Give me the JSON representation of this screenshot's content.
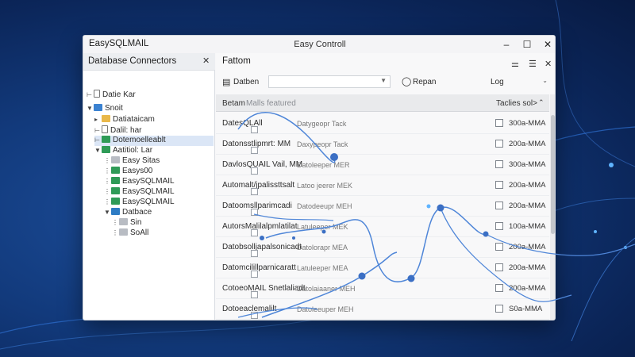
{
  "window": {
    "app_title": "EasySQLMAIL",
    "title": "Easy Controll"
  },
  "left_pane": {
    "title": "Database Connectors",
    "items": [
      {
        "label": "Datie Kar"
      },
      {
        "label": "Snoit"
      },
      {
        "label": "Datiataicam"
      },
      {
        "label": "Dalil: har"
      },
      {
        "label": "Dotemoelleablt"
      },
      {
        "label": "Aatitiol: Lar"
      },
      {
        "label": "Easy Sitas"
      },
      {
        "label": "Easys00"
      },
      {
        "label": "EasySQLMAIL"
      },
      {
        "label": "EasySQLMAIL"
      },
      {
        "label": "EasySQLMAIL"
      },
      {
        "label": "Datbace"
      },
      {
        "label": "Sin"
      },
      {
        "label": "SoAll"
      }
    ]
  },
  "right_pane": {
    "title": "Fattom",
    "toolbar": {
      "db_label": "Datben",
      "report_label": "Repan",
      "log_label": "Log"
    },
    "grid": {
      "col_name": "Betam",
      "col_desc": "Malls featured",
      "col_tables": "Taclies sol>",
      "rows": [
        {
          "name": "DatesQLAll",
          "desc": "Datygeopr  Tack",
          "count": "300a-MMA"
        },
        {
          "name": "Datonsstlipmrt: MM",
          "desc": "Daxypeopr  Tack",
          "count": "200a-MMA"
        },
        {
          "name": "DavlosQUAIL Vail, MM",
          "desc": "Datoleeper  MER",
          "count": "300a-MMA"
        },
        {
          "name": "Automalt/jpalissttsalt",
          "desc": "Latoo jeerer  MEK",
          "count": "200a-MMA"
        },
        {
          "name": "Datoomsllparimcadi",
          "desc": "Datodeeupr  MEH",
          "count": "200a-MMA"
        },
        {
          "name": "AutorsMalilalpmlatilat",
          "desc": "Latuleeper  MEK",
          "count": "100a-MMA"
        },
        {
          "name": "Datobsolljapalsonicadt",
          "desc": "Datolorapr  MEA",
          "count": "200a-MMA"
        },
        {
          "name": "Datomcilillparnicaratt",
          "desc": "Latuleeper  MEA",
          "count": "200a-MMA"
        },
        {
          "name": "CotoeoMAIL Snetlaliadt",
          "desc": "Datolaiaaner  MEH",
          "count": "200a-MMA"
        },
        {
          "name": "Dotoeaclemalilt",
          "desc": "Datoleeuper  MEH",
          "count": "S0a-MMA"
        }
      ]
    }
  },
  "colors": {
    "accent": "#3b6fc4",
    "curve": "#4f86d8",
    "background": "#123a7c"
  },
  "icons": [
    "minimize-icon",
    "maximize-icon",
    "close-icon",
    "pin-icon",
    "filter-icon",
    "database-icon",
    "report-icon",
    "chevron-down-icon",
    "sort-icon",
    "folder-icon",
    "table-icon"
  ]
}
